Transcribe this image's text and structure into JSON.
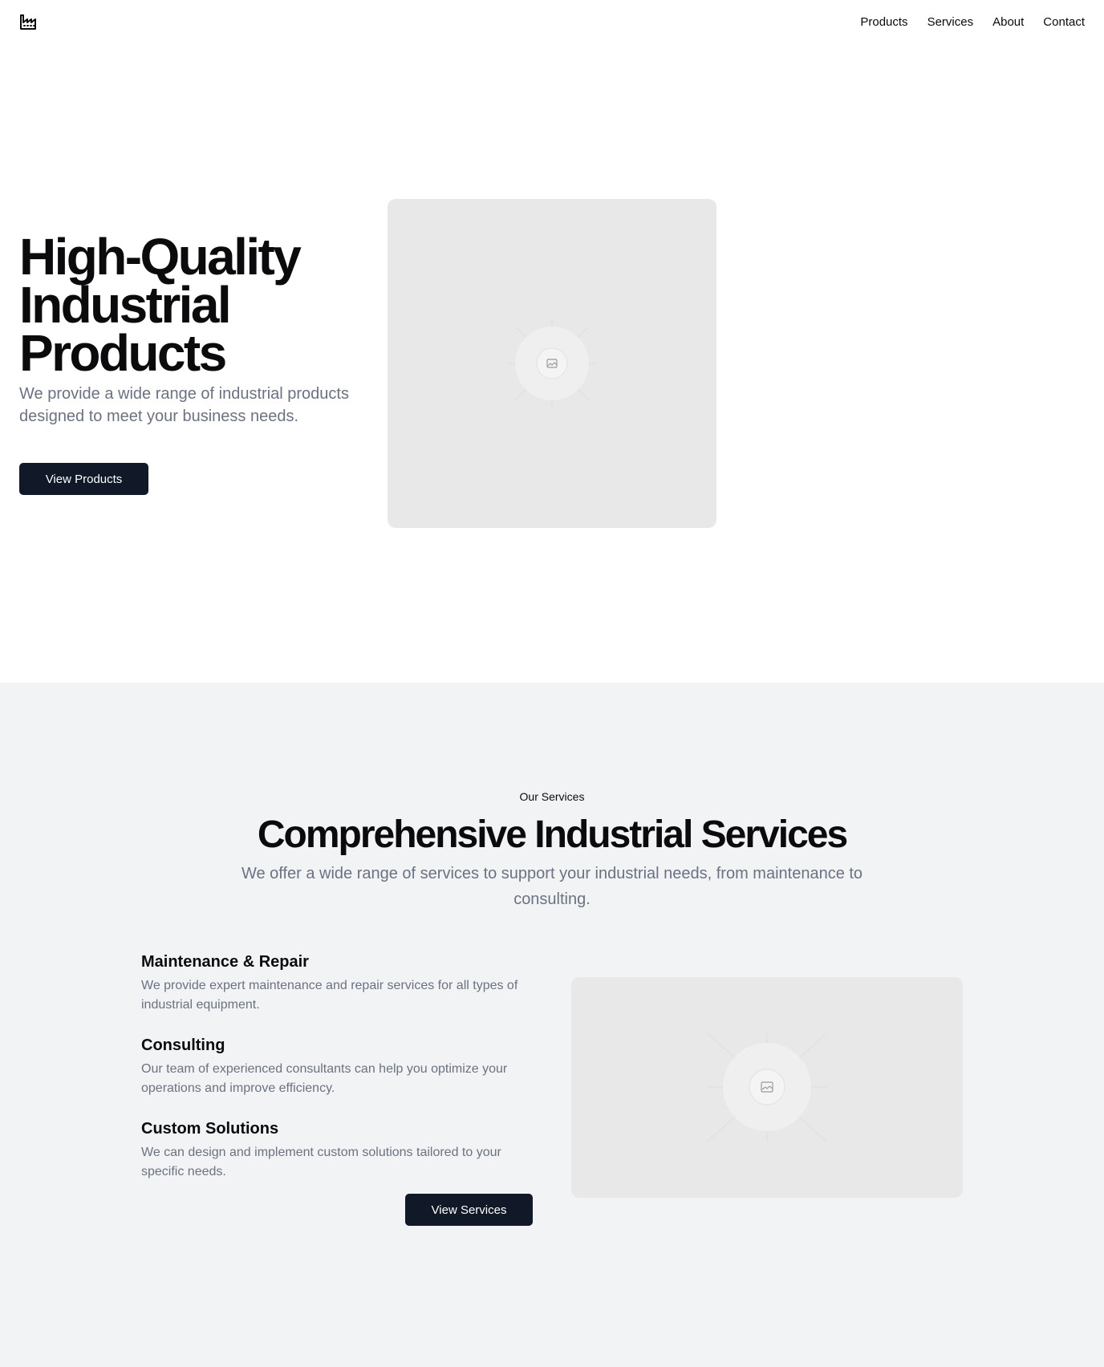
{
  "header": {
    "logo_icon": "factory-icon",
    "nav": [
      {
        "label": "Products"
      },
      {
        "label": "Services"
      },
      {
        "label": "About"
      },
      {
        "label": "Contact"
      }
    ]
  },
  "hero": {
    "title": "High-Quality Industrial Products",
    "subtitle": "We provide a wide range of industrial products designed to meet your business needs.",
    "button_label": "View Products",
    "image_icon": "image-placeholder-icon"
  },
  "services": {
    "eyebrow": "Our Services",
    "title": "Comprehensive Industrial Services",
    "subtitle": "We offer a wide range of services to support your industrial needs, from maintenance to consulting.",
    "items": [
      {
        "title": "Maintenance & Repair",
        "text": "We provide expert maintenance and repair services for all types of industrial equipment."
      },
      {
        "title": "Consulting",
        "text": "Our team of experienced consultants can help you optimize your operations and improve efficiency."
      },
      {
        "title": "Custom Solutions",
        "text": "We can design and implement custom solutions tailored to your specific needs."
      }
    ],
    "button_label": "View Services",
    "image_icon": "image-placeholder-icon"
  },
  "colors": {
    "primary_button": "#111827",
    "muted_text": "#6b7280",
    "section_bg": "#f2f3f5",
    "placeholder_bg": "#e8e8e8"
  }
}
